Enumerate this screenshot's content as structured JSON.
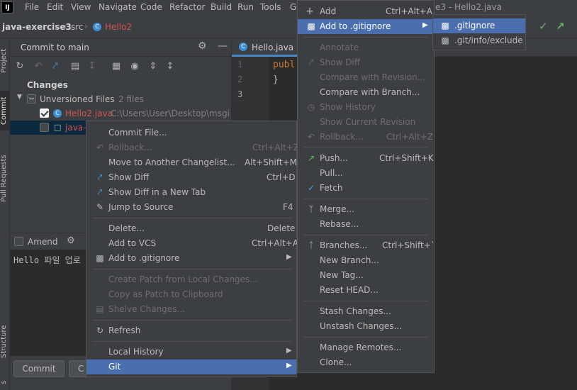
{
  "menubar": {
    "logo": "IJ",
    "items": [
      "File",
      "Edit",
      "View",
      "Navigate",
      "Code",
      "Refactor",
      "Build",
      "Run",
      "Tools",
      "G"
    ],
    "window_title": "e3 - Hello2.java"
  },
  "navbar": {
    "project": "java-exercise3",
    "folder": "src",
    "file": "Hello2"
  },
  "tool_stripe": {
    "project": "Project",
    "commit": "Commit",
    "pull_requests": "Pull Requests",
    "structure": "Structure",
    "bottom": "s"
  },
  "commit_panel": {
    "header_title": "Commit to main",
    "changes_label": "Changes",
    "unversioned_label": "Unversioned Files",
    "unversioned_count": "2 files",
    "file1_name": "Hello2.java",
    "file1_path": "C:\\Users\\User\\Desktop\\msgi",
    "file2_name": "java-e",
    "amend_label": "Amend",
    "message_text": "Hello 파일 업로",
    "commit_button": "Commit",
    "second_button": "C"
  },
  "editor": {
    "tab_label": "Hello.java",
    "line_numbers": [
      "1",
      "2",
      "3"
    ],
    "code_line1": "publ",
    "code_line2": "}"
  },
  "context_menu": {
    "items": {
      "commit_file": "Commit File...",
      "rollback": "Rollback...",
      "rollback_sc": "Ctrl+Alt+Z",
      "move_changelist": "Move to Another Changelist...",
      "move_changelist_sc": "Alt+Shift+M",
      "show_diff": "Show Diff",
      "show_diff_sc": "Ctrl+D",
      "show_diff_new_tab": "Show Diff in a New Tab",
      "jump_to_source": "Jump to Source",
      "jump_to_source_sc": "F4",
      "delete": "Delete...",
      "delete_sc": "Delete",
      "add_to_vcs": "Add to VCS",
      "add_to_vcs_sc": "Ctrl+Alt+A",
      "add_to_gitignore": "Add to .gitignore",
      "create_patch": "Create Patch from Local Changes...",
      "copy_patch": "Copy as Patch to Clipboard",
      "shelve": "Shelve Changes...",
      "refresh": "Refresh",
      "local_history": "Local History",
      "git": "Git"
    }
  },
  "git_menu": {
    "items": {
      "add": "Add",
      "add_sc": "Ctrl+Alt+A",
      "add_gitignore": "Add to .gitignore",
      "annotate": "Annotate",
      "show_diff": "Show Diff",
      "compare_revision": "Compare with Revision...",
      "compare_branch": "Compare with Branch...",
      "show_history": "Show History",
      "show_current_revision": "Show Current Revision",
      "rollback": "Rollback...",
      "rollback_sc": "Ctrl+Alt+Z",
      "push": "Push...",
      "push_sc": "Ctrl+Shift+K",
      "pull": "Pull...",
      "fetch": "Fetch",
      "merge": "Merge...",
      "rebase": "Rebase...",
      "branches": "Branches...",
      "branches_sc": "Ctrl+Shift+`",
      "new_branch": "New Branch...",
      "new_tag": "New Tag...",
      "reset_head": "Reset HEAD...",
      "stash": "Stash Changes...",
      "unstash": "Unstash Changes...",
      "manage_remotes": "Manage Remotes...",
      "clone": "Clone..."
    }
  },
  "gitignore_menu": {
    "items": {
      "gitignore": ".gitignore",
      "exclude": ".git/info/exclude"
    }
  },
  "colors": {
    "selection": "#4b6eaf",
    "menu_bg": "#3c3f41",
    "editor_bg": "#2b2b2b",
    "modified_file": "#d25252",
    "keyword": "#cc7832",
    "green_check": "#5fb85f"
  }
}
